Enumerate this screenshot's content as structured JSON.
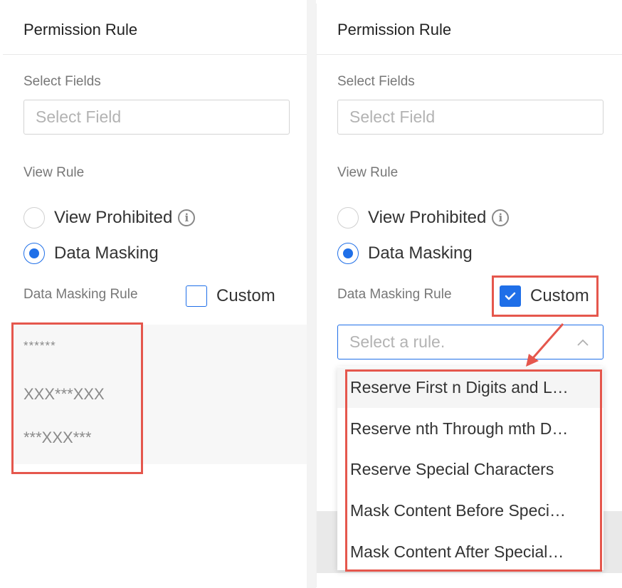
{
  "left": {
    "title": "Permission Rule",
    "select_fields_label": "Select Fields",
    "select_field_placeholder": "Select Field",
    "view_rule_label": "View Rule",
    "options": {
      "prohibited": "View Prohibited",
      "masking": "Data Masking"
    },
    "selected_option": "masking",
    "masking_rule_label": "Data Masking Rule",
    "custom_label": "Custom",
    "custom_checked": false,
    "mask_examples": [
      "******",
      "XXX***XXX",
      "***XXX***"
    ]
  },
  "right": {
    "title": "Permission Rule",
    "select_fields_label": "Select Fields",
    "select_field_placeholder": "Select Field",
    "view_rule_label": "View Rule",
    "options": {
      "prohibited": "View Prohibited",
      "masking": "Data Masking"
    },
    "selected_option": "masking",
    "masking_rule_label": "Data Masking Rule",
    "custom_label": "Custom",
    "custom_checked": true,
    "rule_placeholder": "Select a rule.",
    "rule_options": [
      "Reserve First n Digits and L…",
      "Reserve nth Through mth D…",
      "Reserve Special Characters",
      "Mask Content Before Speci…",
      "Mask Content After Special…"
    ]
  },
  "colors": {
    "accent": "#1f6fe8",
    "highlight": "#e5574d"
  },
  "icons": {
    "info": "info-icon",
    "check": "check-icon",
    "chevron": "chevron-up-icon",
    "arrow": "annotation-arrow"
  }
}
